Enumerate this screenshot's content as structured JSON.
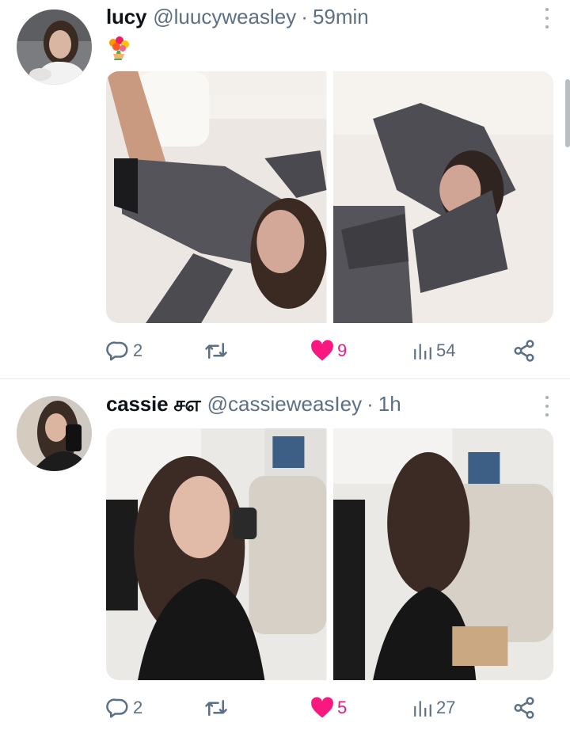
{
  "posts": [
    {
      "name": "lucy",
      "handle": "@luucyweasley",
      "separator": "·",
      "time": "59min",
      "text_emoji": "bouquet-emoji",
      "media": [
        "photo-1",
        "photo-2"
      ],
      "actions": {
        "replies": "2",
        "likes": "9",
        "views": "54"
      }
    },
    {
      "name": "cassie சஎ",
      "handle": "@cassieweasIey",
      "separator": "·",
      "time": "1h",
      "media": [
        "photo-1",
        "photo-2"
      ],
      "actions": {
        "replies": "2",
        "likes": "5",
        "views": "27"
      }
    }
  ],
  "colors": {
    "like": "#f91880",
    "muted": "#5b7083",
    "divider": "#e6e9ec"
  },
  "icons": [
    "reply-icon",
    "retweet-icon",
    "heart-icon",
    "views-icon",
    "share-icon",
    "more-icon"
  ]
}
